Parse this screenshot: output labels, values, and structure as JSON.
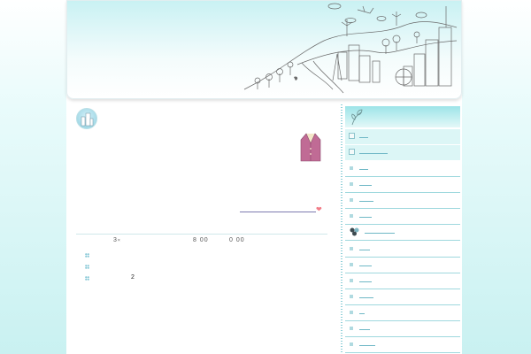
{
  "header": {
    "banner": "city-skyline-illustration"
  },
  "main": {
    "avatar_icon": "city-avatar-icon",
    "decoration_icon": "coat-icon",
    "heart_icon": "heart-icon",
    "meta": {
      "count": "3",
      "time_start": "8 00",
      "time_end": "0 00"
    },
    "bullets": [
      {
        "text": ""
      },
      {
        "text": ""
      },
      {
        "text": "2"
      }
    ]
  },
  "sidebar": {
    "header_icon": "leaf-icon",
    "items": [
      {
        "style": "highlight",
        "line_width": 10
      },
      {
        "style": "highlight",
        "line_width": 32
      },
      {
        "style": "normal",
        "line_width": 10
      },
      {
        "style": "normal",
        "line_width": 14
      },
      {
        "style": "normal",
        "line_width": 16
      },
      {
        "style": "normal",
        "line_width": 14
      },
      {
        "style": "flower",
        "line_width": 34
      },
      {
        "style": "normal",
        "line_width": 12
      },
      {
        "style": "normal",
        "line_width": 14
      },
      {
        "style": "normal",
        "line_width": 14
      },
      {
        "style": "normal",
        "line_width": 16
      },
      {
        "style": "normal",
        "line_width": 6
      },
      {
        "style": "normal",
        "line_width": 12
      },
      {
        "style": "normal",
        "line_width": 18
      }
    ]
  }
}
